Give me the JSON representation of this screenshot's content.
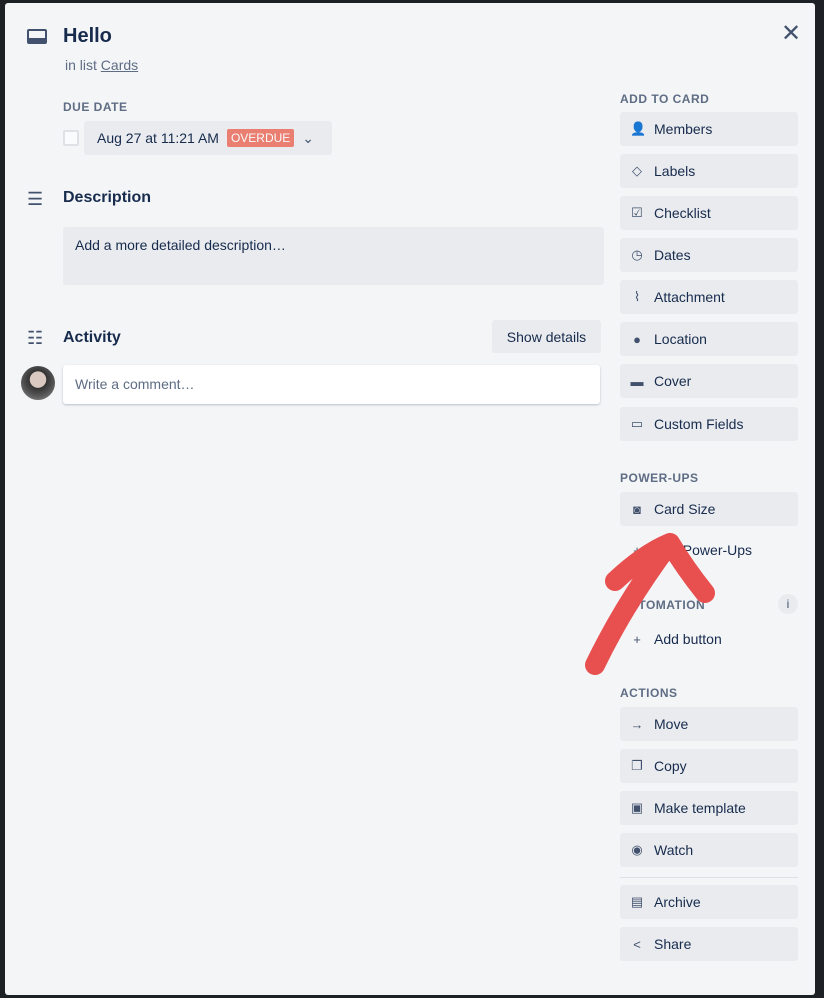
{
  "card": {
    "title": "Hello",
    "in_list_prefix": "in list",
    "list_name": "Cards"
  },
  "due": {
    "label": "DUE DATE",
    "value": "Aug 27 at 11:21 AM",
    "badge": "OVERDUE"
  },
  "description": {
    "heading": "Description",
    "placeholder": "Add a more detailed description…"
  },
  "activity": {
    "heading": "Activity",
    "show_details": "Show details",
    "comment_placeholder": "Write a comment…"
  },
  "sidebar": {
    "add_label": "ADD TO CARD",
    "add": [
      {
        "label": "Members",
        "icon": "👤"
      },
      {
        "label": "Labels",
        "icon": "◇"
      },
      {
        "label": "Checklist",
        "icon": "☑"
      },
      {
        "label": "Dates",
        "icon": "◷"
      },
      {
        "label": "Attachment",
        "icon": "⌇"
      },
      {
        "label": "Location",
        "icon": "●"
      },
      {
        "label": "Cover",
        "icon": "▬"
      },
      {
        "label": "Custom Fields",
        "icon": "▭"
      }
    ],
    "powerups_label": "POWER-UPS",
    "powerups": [
      {
        "label": "Card Size",
        "icon": "◙"
      },
      {
        "label": "Add Power-Ups",
        "icon": "+"
      }
    ],
    "automation_label": "AUTOMATION",
    "automation": [
      {
        "label": "Add button",
        "icon": "+"
      }
    ],
    "actions_label": "ACTIONS",
    "actions": [
      {
        "label": "Move",
        "icon": "→"
      },
      {
        "label": "Copy",
        "icon": "❐"
      },
      {
        "label": "Make template",
        "icon": "▣"
      },
      {
        "label": "Watch",
        "icon": "◉"
      },
      {
        "label": "Archive",
        "icon": "▤"
      },
      {
        "label": "Share",
        "icon": "<"
      }
    ]
  },
  "annotation_color": "#e84f4f"
}
